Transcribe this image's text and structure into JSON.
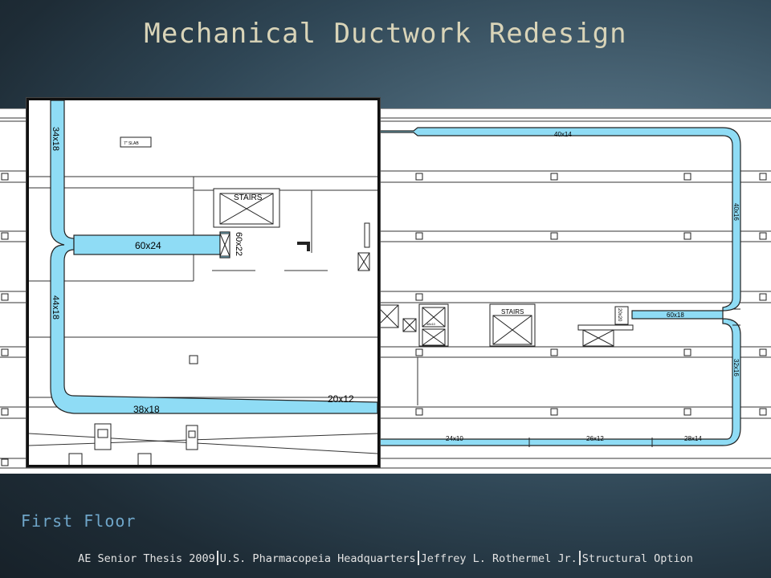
{
  "title": "Mechanical Ductwork Redesign",
  "caption": "First Floor",
  "footer": {
    "thesis": "AE Senior Thesis 2009",
    "project": "U.S. Pharmacopeia Headquarters",
    "author": "Jeffrey L. Rothermel Jr.",
    "option": "Structural Option"
  },
  "plan_labels": {
    "duct_40x14": "40x14",
    "duct_40x16": "40x16",
    "duct_60x18": "60x18",
    "duct_32x16": "32x16",
    "duct_24x10": "24x10",
    "duct_26x12": "26x12",
    "duct_28x14": "28x14",
    "duct_20x20": "20x20",
    "stairs": "STAIRS",
    "small_tag": "48x10"
  },
  "inset_labels": {
    "duct_34x18": "34x18",
    "duct_60x24": "60x24",
    "duct_60x22": "60x22",
    "duct_44x18": "44x18",
    "duct_38x18": "38x18",
    "duct_20x12": "20x12",
    "slab": "7\" SLAB",
    "stairs": "STAIRS"
  },
  "colors": {
    "duct_fill": "#8fdcf5",
    "line": "#222222",
    "title": "#d9d4b8",
    "caption": "#6fa6c9"
  }
}
